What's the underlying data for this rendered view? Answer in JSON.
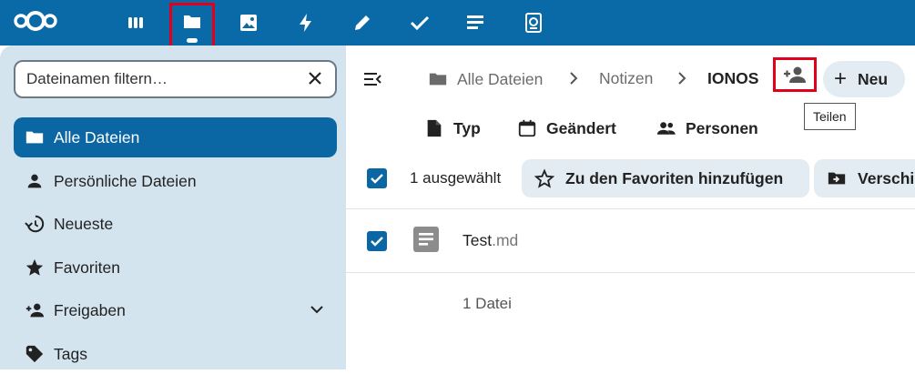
{
  "topbar": {
    "logo_icon": "nextcloud-logo",
    "apps": [
      {
        "name": "dashboard-icon"
      },
      {
        "name": "files-icon",
        "active": true
      },
      {
        "name": "photos-icon"
      },
      {
        "name": "activity-icon"
      },
      {
        "name": "notes-icon"
      },
      {
        "name": "tasks-icon"
      },
      {
        "name": "deck-icon"
      },
      {
        "name": "contacts-icon"
      }
    ]
  },
  "sidebar": {
    "filter_placeholder": "Dateinamen filtern…",
    "items": [
      {
        "label": "Alle Dateien",
        "icon": "folder-icon",
        "active": true
      },
      {
        "label": "Persönliche Dateien",
        "icon": "account-icon"
      },
      {
        "label": "Neueste",
        "icon": "history-icon"
      },
      {
        "label": "Favoriten",
        "icon": "star-icon"
      },
      {
        "label": "Freigaben",
        "icon": "account-plus-icon",
        "expandable": true
      },
      {
        "label": "Tags",
        "icon": "tag-icon"
      }
    ]
  },
  "breadcrumb": {
    "items": [
      "Alle Dateien",
      "Notizen",
      "IONOS"
    ]
  },
  "toolbar": {
    "new_label": "Neu",
    "share_tooltip": "Teilen"
  },
  "filters": [
    {
      "label": "Typ",
      "icon": "file-icon"
    },
    {
      "label": "Geändert",
      "icon": "calendar-icon"
    },
    {
      "label": "Personen",
      "icon": "account-group-icon"
    }
  ],
  "selection": {
    "text": "1 ausgewählt",
    "actions": [
      {
        "label": "Zu den Favoriten hinzufügen",
        "icon": "star-outline-icon"
      },
      {
        "label": "Verschi",
        "icon": "folder-move-icon"
      }
    ]
  },
  "files": [
    {
      "basename": "Test",
      "extension": ".md",
      "icon": "text-file-icon",
      "selected": true
    }
  ],
  "summary": "1 Datei",
  "colors": {
    "accent": "#0b67a3",
    "topbar": "#0a6aa8",
    "sidebar": "#d3e4ef",
    "highlight": "#e3001b"
  }
}
